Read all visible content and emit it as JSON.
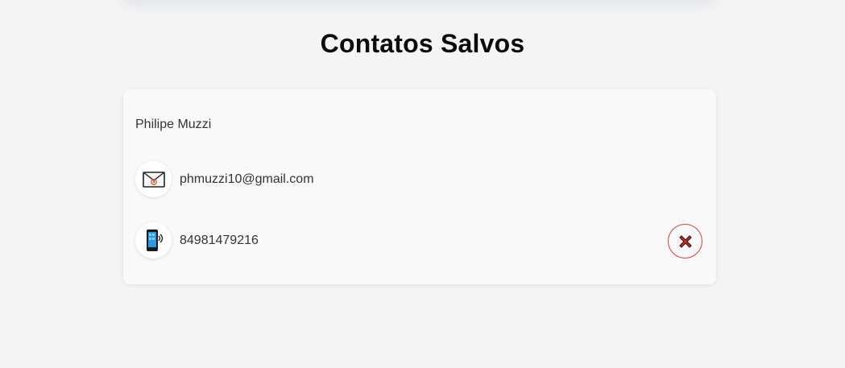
{
  "header": {
    "title": "Contatos Salvos"
  },
  "contact": {
    "name": "Philipe Muzzi",
    "email": "phmuzzi10@gmail.com",
    "phone": "84981479216",
    "email_icon": "envelope-icon",
    "phone_icon": "mobile-phone-icon",
    "delete_icon": "close-icon"
  },
  "colors": {
    "background": "#f4f4f4",
    "card": "#f9f9f9",
    "delete_accent": "#d9413a",
    "text": "#333333"
  }
}
